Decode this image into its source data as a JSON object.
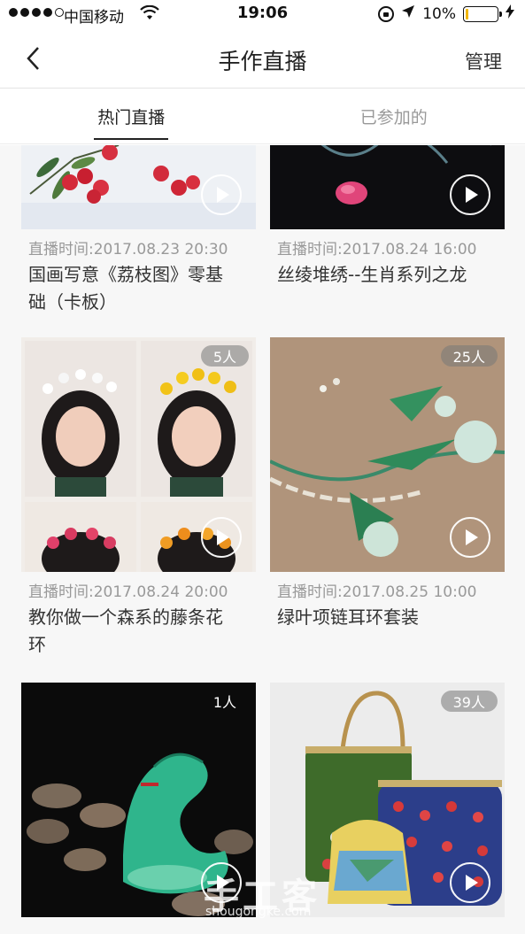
{
  "status_bar": {
    "carrier": "中国移动",
    "time": "19:06",
    "battery_percent": "10%",
    "battery_level": 0.1,
    "icons": [
      "signal-dots-icon",
      "wifi-icon",
      "rotation-lock-icon",
      "location-arrow-icon",
      "battery-icon",
      "charging-bolt-icon"
    ]
  },
  "nav": {
    "title": "手作直播",
    "manage_label": "管理",
    "back_icon": "chevron-left-icon"
  },
  "tabs": [
    {
      "label": "热门直播",
      "active": true
    },
    {
      "label": "已参加的",
      "active": false
    }
  ],
  "cards": [
    {
      "time": "直播时间:2017.08.23 20:30",
      "title_line1": "国画写意《荔枝图》零基",
      "title_line2": "础（卡板）",
      "viewers": ""
    },
    {
      "time": "直播时间:2017.08.24 16:00",
      "title_line1": "丝绫堆绣--生肖系列之龙",
      "title_line2": "",
      "viewers": ""
    },
    {
      "time": "直播时间:2017.08.24 20:00",
      "title_line1": "教你做一个森系的藤条花",
      "title_line2": "环",
      "viewers": "5人"
    },
    {
      "time": "直播时间:2017.08.25 10:00",
      "title_line1": "绿叶项链耳环套装",
      "title_line2": "",
      "viewers": "25人"
    },
    {
      "time": "",
      "title_line1": "",
      "title_line2": "",
      "viewers": "1人"
    },
    {
      "time": "",
      "title_line1": "",
      "title_line2": "",
      "viewers": "39人"
    }
  ],
  "watermark": {
    "text": "手工客",
    "sub": "shougongke.com"
  }
}
